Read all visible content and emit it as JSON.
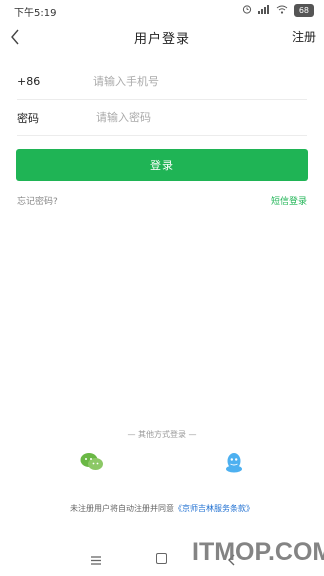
{
  "status_bar": {
    "time": "下午5:19",
    "battery": "68"
  },
  "header": {
    "title": "用户登录",
    "register_label": "注册"
  },
  "form": {
    "phone_prefix": "+86",
    "phone_placeholder": "请输入手机号",
    "password_label": "密码",
    "password_placeholder": "请输入密码",
    "login_label": "登录"
  },
  "links": {
    "forgot_password": "忘记密码?",
    "sms_login": "短信登录"
  },
  "other_login": {
    "divider_text": "— 其他方式登录 —",
    "icons": [
      "wechat-icon",
      "qq-icon"
    ]
  },
  "agreement": {
    "text": "未注册用户将自动注册并同意",
    "link": "《京师吉林服务条款》"
  },
  "watermark": "ITMOP.COM",
  "colors": {
    "accent": "#1fb455",
    "link": "#1e6fd1",
    "qq": "#4db0f0"
  }
}
